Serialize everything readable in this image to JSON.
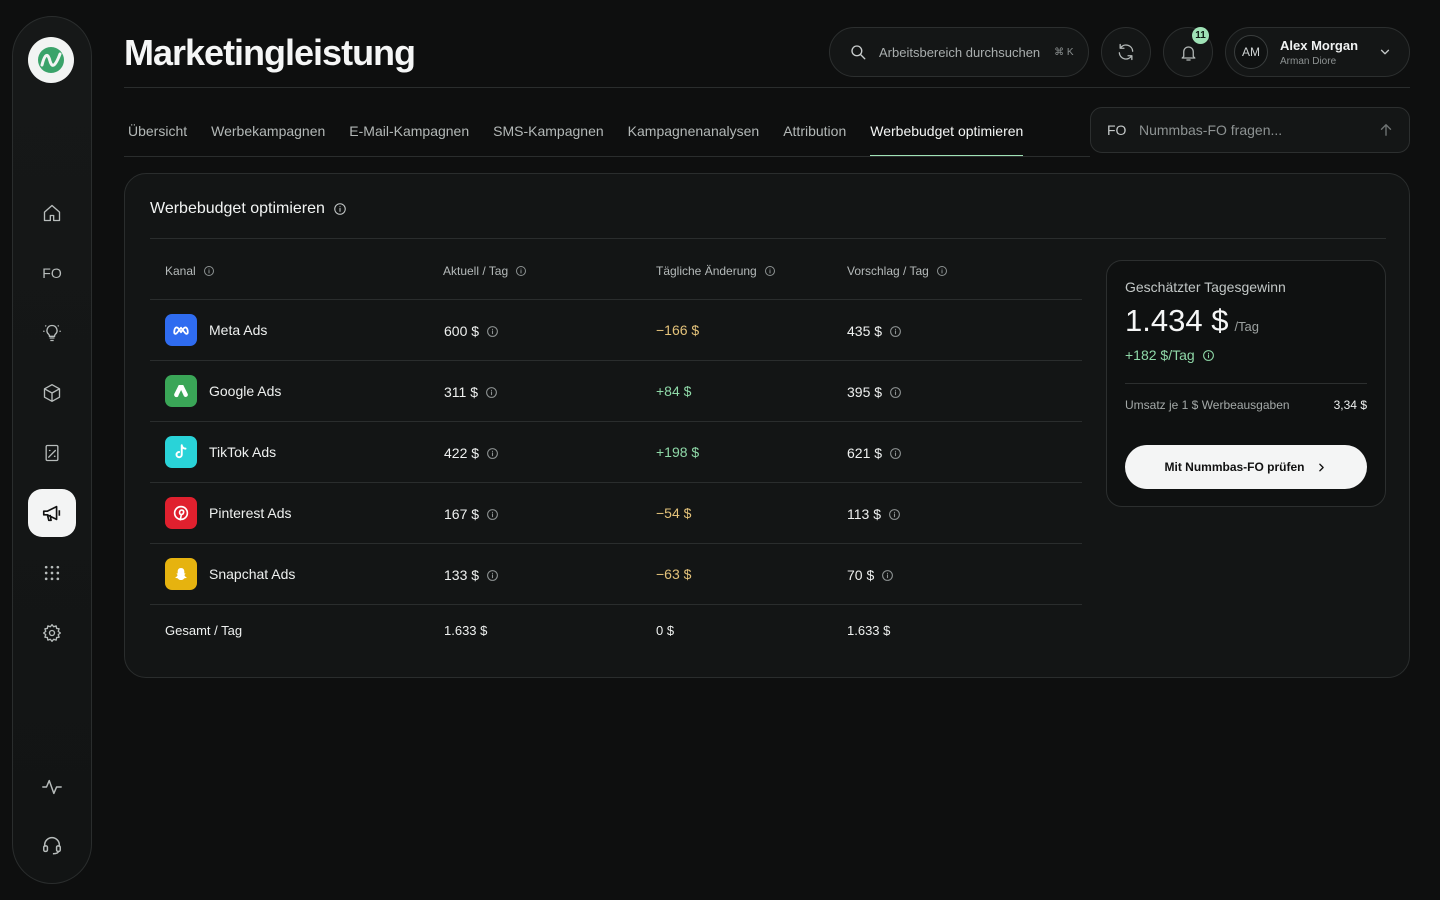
{
  "page": {
    "title": "Marketingleistung"
  },
  "header": {
    "search_placeholder": "Arbeitsbereich durchsuchen",
    "search_shortcut": "⌘ K",
    "notification_count": "11",
    "user": {
      "initials": "AM",
      "name": "Alex Morgan",
      "subtitle": "Arman Diore"
    }
  },
  "sidebar": {
    "items": [
      {
        "name": "home-icon"
      },
      {
        "name": "fo-icon",
        "label": "FO"
      },
      {
        "name": "lightbulb-icon"
      },
      {
        "name": "box-icon"
      },
      {
        "name": "report-icon"
      },
      {
        "name": "megaphone-icon",
        "active": true
      },
      {
        "name": "apps-grid-icon"
      },
      {
        "name": "gear-icon"
      },
      {
        "name": "activity-icon"
      },
      {
        "name": "headset-icon"
      }
    ]
  },
  "tabs": [
    {
      "label": "Übersicht"
    },
    {
      "label": "Werbekampagnen"
    },
    {
      "label": "E-Mail-Kampagnen"
    },
    {
      "label": "SMS-Kampagnen"
    },
    {
      "label": "Kampagnenanalysen"
    },
    {
      "label": "Attribution"
    },
    {
      "label": "Werbebudget optimieren",
      "active": true
    }
  ],
  "ask": {
    "prefix": "FO",
    "placeholder": "Nummbas-FO fragen..."
  },
  "card": {
    "title": "Werbebudget optimieren",
    "columns": [
      "Kanal",
      "Aktuell / Tag",
      "Tägliche Änderung",
      "Vorschlag / Tag"
    ],
    "rows": [
      {
        "channel": "Meta Ads",
        "current": "600 $",
        "change": "−166 $",
        "suggested": "435 $",
        "icon_color": "#2f6cf0",
        "trend": "neg"
      },
      {
        "channel": "Google Ads",
        "current": "311 $",
        "change": "+84 $",
        "suggested": "395 $",
        "icon_color": "#3aa657",
        "trend": "pos"
      },
      {
        "channel": "TikTok Ads",
        "current": "422 $",
        "change": "+198 $",
        "suggested": "621 $",
        "icon_color": "#29d3d8",
        "trend": "pos"
      },
      {
        "channel": "Pinterest Ads",
        "current": "167 $",
        "change": "−54 $",
        "suggested": "113 $",
        "icon_color": "#e0202e",
        "trend": "neg"
      },
      {
        "channel": "Snapchat Ads",
        "current": "133 $",
        "change": "−63 $",
        "suggested": "70 $",
        "icon_color": "#e6b30f",
        "trend": "neg"
      }
    ],
    "total": {
      "label": "Gesamt / Tag",
      "current": "1.633 $",
      "change": "0 $",
      "suggested": "1.633 $"
    }
  },
  "panel": {
    "label": "Geschätzter Tagesgewinn",
    "value": "1.434 $",
    "unit": "/Tag",
    "delta": "+182 $/Tag",
    "roas_label": "Umsatz je 1 $ Werbeausgaben",
    "roas_value": "3,34 $",
    "button_label": "Mit Nummbas-FO prüfen"
  },
  "colors": {
    "accent": "#9fe2b6",
    "negative": "#e3c27a",
    "positive": "#8fd9a8",
    "background": "#0e0f0f"
  }
}
